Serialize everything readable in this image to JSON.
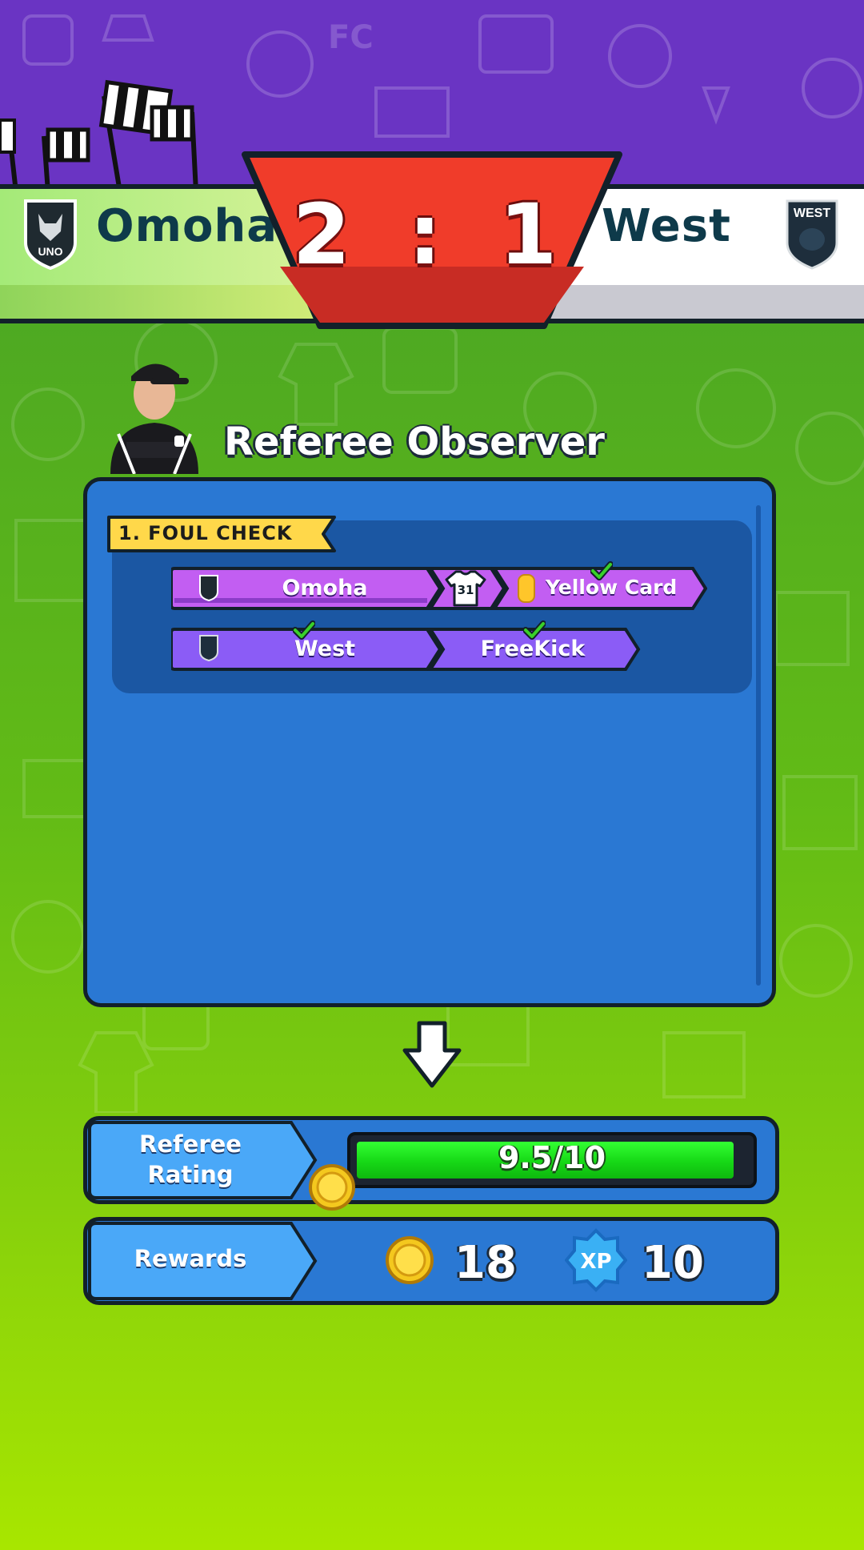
{
  "scoreboard": {
    "home_team": "Omoha",
    "away_team": "West",
    "home_crest_text": "UNO",
    "away_crest_text": "WEST",
    "score": "2 : 1"
  },
  "panel": {
    "title": "Referee Observer",
    "section_label": "1. FOUL CHECK",
    "fouls": [
      {
        "team": "Omoha",
        "player_number": "31",
        "decision": "Yellow Card"
      },
      {
        "team": "West",
        "decision": "FreeKick"
      }
    ]
  },
  "rating": {
    "label_line1": "Referee",
    "label_line2": "Rating",
    "value_text": "9.5/10",
    "fraction": 0.95
  },
  "rewards": {
    "label": "Rewards",
    "coins": "18",
    "xp": "10",
    "xp_badge": "XP"
  },
  "colors": {
    "panel_blue": "#2a78d3",
    "chip_purple": "#c25ef2",
    "chip_violet": "#8b5cf6",
    "score_red": "#f03c2a",
    "progress_green": "#16d816"
  }
}
